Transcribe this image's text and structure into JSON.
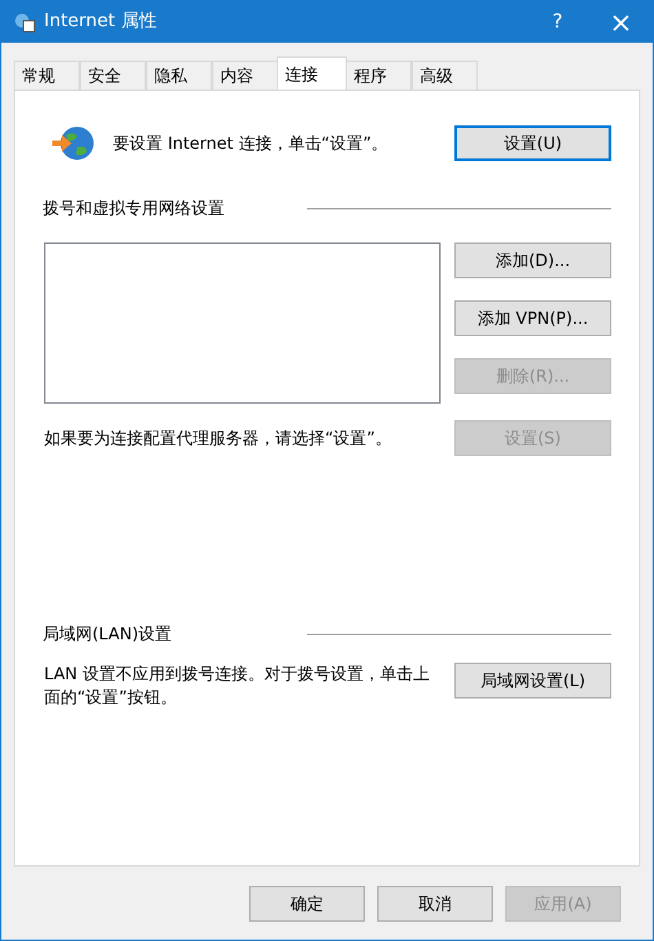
{
  "window": {
    "title": "Internet 属性",
    "help": "?",
    "close": "×"
  },
  "tabs": [
    {
      "label": "常规",
      "selected": false
    },
    {
      "label": "安全",
      "selected": false
    },
    {
      "label": "隐私",
      "selected": false
    },
    {
      "label": "内容",
      "selected": false
    },
    {
      "label": "连接",
      "selected": true
    },
    {
      "label": "程序",
      "selected": false
    },
    {
      "label": "高级",
      "selected": false
    }
  ],
  "setup": {
    "text": "要设置 Internet 连接，单击“设置”。",
    "button": {
      "label": "设置(U)",
      "disabled": false
    }
  },
  "dialup": {
    "heading": "拨号和虚拟专用网络设置",
    "buttons": [
      {
        "label": "添加(D)...",
        "disabled": false
      },
      {
        "label": "添加 VPN(P)...",
        "disabled": false
      },
      {
        "label": "删除(R)...",
        "disabled": true
      }
    ],
    "proxy_text": "如果要为连接配置代理服务器，请选择“设置”。",
    "settings_button": {
      "label": "设置(S)",
      "disabled": true
    }
  },
  "lan": {
    "heading": "局域网(LAN)设置",
    "text": "LAN 设置不应用到拨号连接。对于拨号设置，单击上面的“设置”按钮。",
    "button": {
      "label": "局域网设置(L)",
      "disabled": false
    }
  },
  "footer_buttons": [
    {
      "label": "确定",
      "disabled": false
    },
    {
      "label": "取消",
      "disabled": false
    },
    {
      "label": "应用(A)",
      "disabled": true
    }
  ]
}
